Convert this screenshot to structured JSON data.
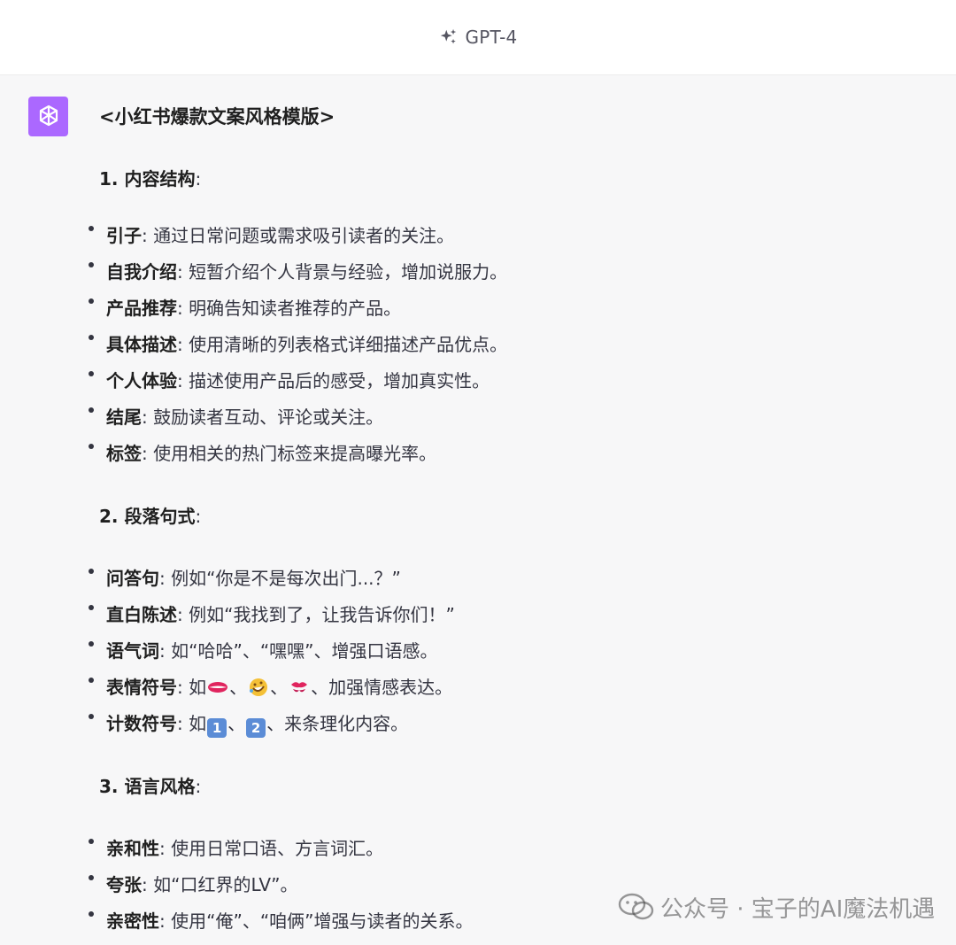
{
  "header": {
    "model_label": "GPT-4",
    "icon": "sparkle-icon"
  },
  "assistant": {
    "avatar_icon": "openai-logo-icon",
    "avatar_color": "#ab68ff"
  },
  "doc": {
    "title": "<小红书爆款文案风格模版>",
    "sections": [
      {
        "heading_bold": "1. 内容结构",
        "heading_suffix": ":",
        "items": [
          {
            "term": "引子",
            "text": ": 通过日常问题或需求吸引读者的关注。"
          },
          {
            "term": "自我介绍",
            "text": ": 短暂介绍个人背景与经验，增加说服力。"
          },
          {
            "term": "产品推荐",
            "text": ": 明确告知读者推荐的产品。"
          },
          {
            "term": "具体描述",
            "text": ": 使用清晰的列表格式详细描述产品优点。"
          },
          {
            "term": "个人体验",
            "text": ": 描述使用产品后的感受，增加真实性。"
          },
          {
            "term": "结尾",
            "text": ": 鼓励读者互动、评论或关注。"
          },
          {
            "term": "标签",
            "text": ": 使用相关的热门标签来提高曝光率。"
          }
        ]
      },
      {
        "heading_bold": "2. 段落句式",
        "heading_suffix": ":",
        "items": [
          {
            "term": "问答句",
            "text": ": 例如“你是不是每次出门...？”"
          },
          {
            "term": "直白陈述",
            "text": ": 例如“我找到了，让我告诉你们！”"
          },
          {
            "term": "语气词",
            "text": ": 如“哈哈”、“嘿嘿”、增强口语感。"
          },
          {
            "term": "表情符号",
            "text_before": ": 如",
            "sep": "、",
            "text_after": "、加强情感表达。",
            "emojis": [
              "lips-emoji",
              "rofl-emoji",
              "kiss-mark-emoji"
            ]
          },
          {
            "term": "计数符号",
            "text_before": ": 如",
            "sep": "、",
            "text_after": "、来条理化内容。",
            "keycaps": [
              "1",
              "2"
            ]
          }
        ]
      },
      {
        "heading_bold": "3. 语言风格",
        "heading_suffix": ":",
        "items": [
          {
            "term": "亲和性",
            "text": ": 使用日常口语、方言词汇。"
          },
          {
            "term": "夸张",
            "text": ": 如“口红界的LV”。"
          },
          {
            "term": "亲密性",
            "text": ": 使用“俺”、“咱俩”增强与读者的关系。"
          }
        ]
      }
    ]
  },
  "watermark": {
    "text": "公众号 · 宝子的AI魔法机遇",
    "icon": "wechat-icon"
  }
}
